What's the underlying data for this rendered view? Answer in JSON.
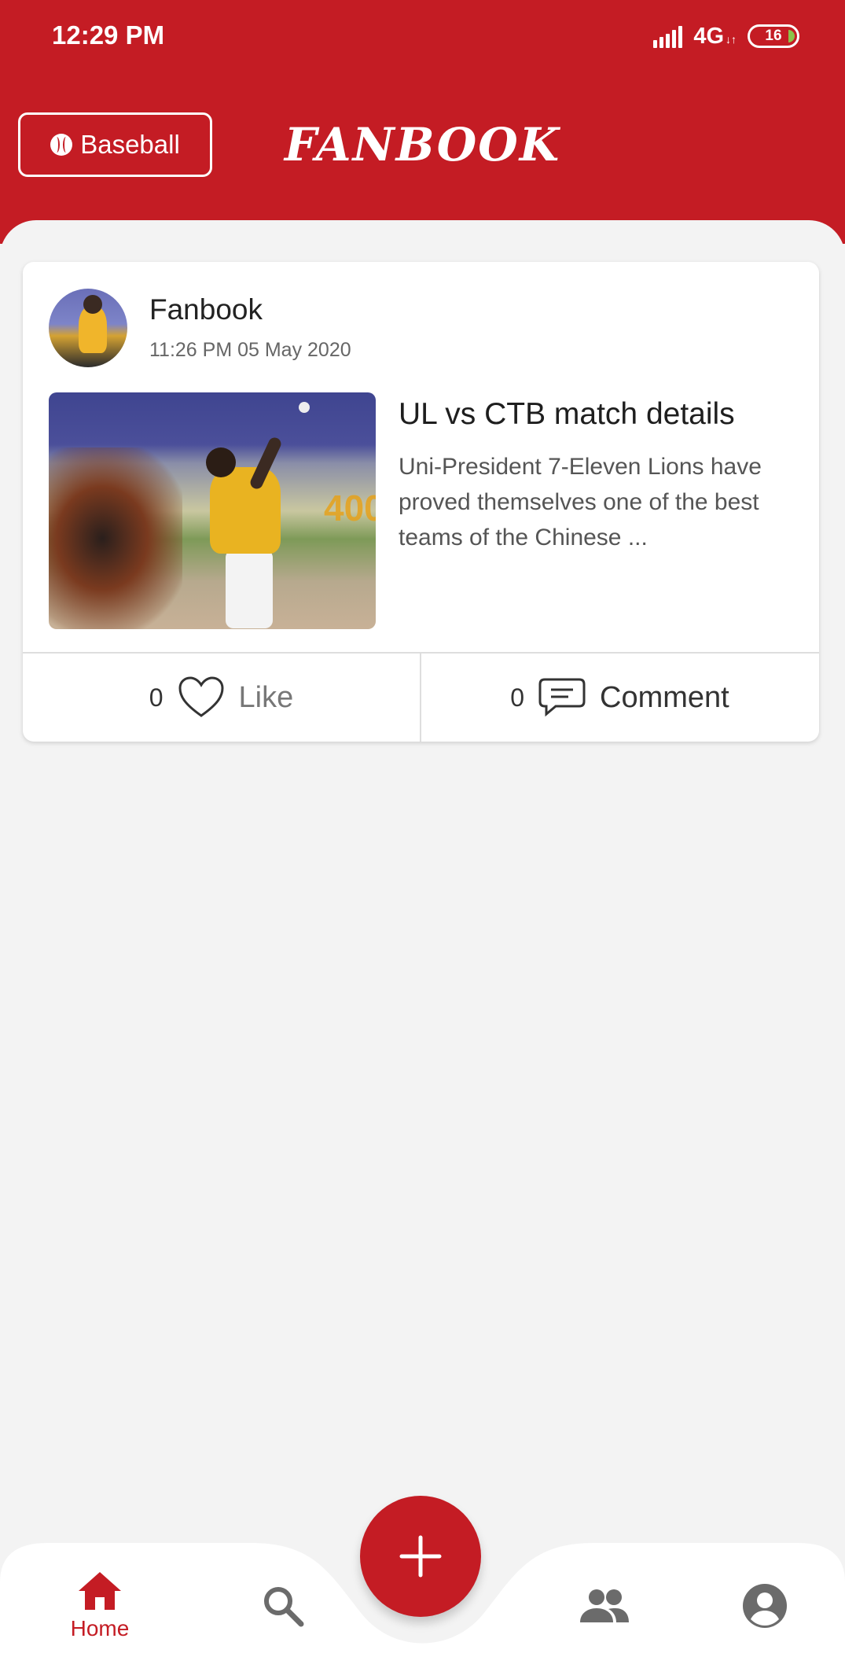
{
  "status_bar": {
    "time": "12:29 PM",
    "network": "4G",
    "network_sub": "↓↑",
    "battery": "16"
  },
  "header": {
    "sport_button_label": "Baseball",
    "brand": "FANBOOK"
  },
  "post": {
    "author": "Fanbook",
    "timestamp": "11:26 PM 05 May 2020",
    "title": "UL vs CTB match details",
    "excerpt": "Uni-President 7-Eleven Lions have proved themselves one of the best teams of the Chinese ...",
    "like_count": "0",
    "like_label": "Like",
    "comment_count": "0",
    "comment_label": "Comment"
  },
  "bottom_nav": {
    "items": [
      {
        "label": "Home",
        "icon": "home-icon",
        "active": true
      },
      {
        "label": "",
        "icon": "search-icon",
        "active": false
      },
      {
        "label": "",
        "icon": "people-icon",
        "active": false
      },
      {
        "label": "",
        "icon": "account-icon",
        "active": false
      }
    ],
    "fab_icon": "plus-icon"
  },
  "colors": {
    "primary": "#c41c24",
    "background": "#f3f3f3",
    "icon_inactive": "#6b6b6b"
  }
}
